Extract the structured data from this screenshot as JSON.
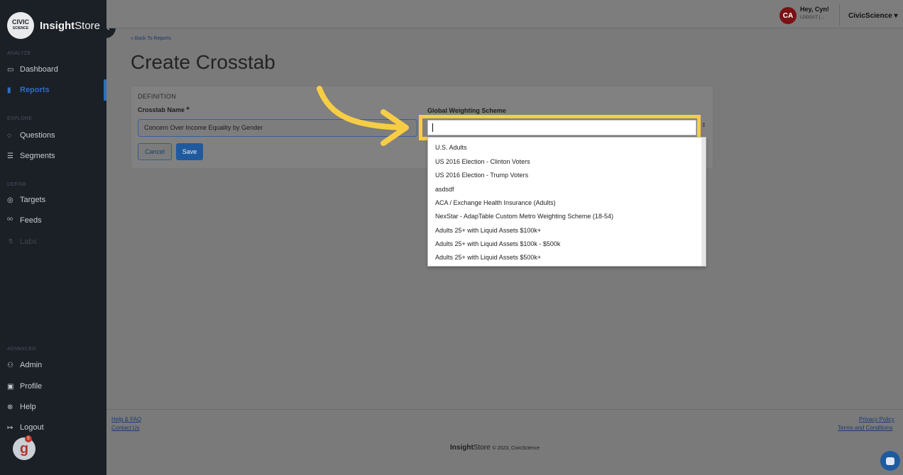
{
  "brand": {
    "logo_text": "CIVIC",
    "logo_sub": "SCIENCE",
    "name_bold": "Insight",
    "name_rest": "Store"
  },
  "sidebar": {
    "sections": [
      {
        "label": "ANALYZE"
      },
      {
        "label": "EXPLORE"
      },
      {
        "label": "DEFINE"
      },
      {
        "label": "ADVANCED"
      }
    ],
    "items": [
      {
        "label": "Dashboard",
        "icon": "dashboard-icon"
      },
      {
        "label": "Reports",
        "icon": "reports-icon",
        "active": true
      },
      {
        "label": "Questions",
        "icon": "questions-icon"
      },
      {
        "label": "Segments",
        "icon": "segments-icon"
      },
      {
        "label": "Targets",
        "icon": "targets-icon"
      },
      {
        "label": "Feeds",
        "icon": "feeds-icon"
      },
      {
        "label": "Labs",
        "icon": "labs-icon",
        "disabled": true
      },
      {
        "label": "Admin",
        "icon": "admin-icon"
      },
      {
        "label": "Profile",
        "icon": "profile-icon"
      },
      {
        "label": "Help",
        "icon": "help-icon"
      },
      {
        "label": "Logout",
        "icon": "logout-icon"
      }
    ],
    "badge_count": "5"
  },
  "header": {
    "avatar_initials": "CA",
    "greeting": "Hey, Cyn!",
    "logout": "LOGOUT",
    "org": "CivicScience"
  },
  "main": {
    "back_link": "« Back To Reports",
    "title": "Create Crosstab",
    "section_label": "DEFINITION",
    "name_label": "Crosstab Name",
    "name_required": "*",
    "name_value": "Concern Over Income Equality by Gender",
    "cancel_label": "Cancel",
    "save_label": "Save",
    "weight_label": "Global Weighting Scheme",
    "weight_value": "",
    "dropdown_options": [
      "U.S. Adults",
      "US 2016 Election - Clinton Voters",
      "US 2016 Election - Trump Voters",
      "asdsdf",
      "ACA / Exchange Health Insurance (Adults)",
      "NexStar - AdapTable Custom Metro Weighting Scheme (18-54)",
      "Adults 25+ with Liquid Assets $100k+",
      "Adults 25+ with Liquid Assets $100k - $500k",
      "Adults 25+ with Liquid Assets $500k+"
    ]
  },
  "footer": {
    "help_faq": "Help & FAQ",
    "contact": "Contact Us",
    "privacy": "Privacy Policy",
    "terms": "Terms and Conditions",
    "brand_bold": "Insight",
    "brand_rest": "Store",
    "copyright": "© 2023, CivicScience"
  },
  "colors": {
    "accent": "#f8cd46",
    "primary": "#1f5a9e",
    "sidebar_bg": "#1b1f26",
    "avatar": "#7a1115"
  }
}
